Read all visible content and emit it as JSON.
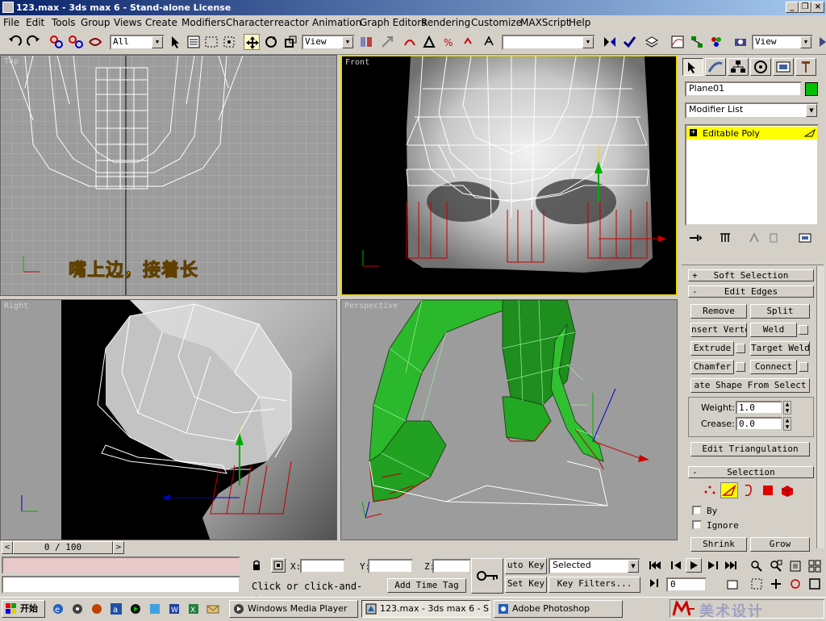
{
  "window": {
    "title": "123.max - 3ds max 6 - Stand-alone License"
  },
  "menu": [
    "File",
    "Edit",
    "Tools",
    "Group",
    "Views",
    "Create",
    "Modifiers",
    "Character",
    "reactor",
    "Animation",
    "Graph Editors",
    "Rendering",
    "Customize",
    "MAXScript",
    "Help"
  ],
  "toolbar": {
    "selection_filter": "All",
    "ref_coord": "View",
    "named_sel": "",
    "render_view": "View"
  },
  "viewports": {
    "top": {
      "label": "Top",
      "annotation": "嘴上边，接着长"
    },
    "front": {
      "label": "Front"
    },
    "right": {
      "label": "Right"
    },
    "perspective": {
      "label": "Perspective"
    }
  },
  "command_panel": {
    "object_name": "Plane01",
    "object_color": "#00c000",
    "modifier_list": "Modifier List",
    "stack_item": "Editable Poly",
    "soft_selection": "Soft Selection",
    "edit_edges": "Edit Edges",
    "buttons": {
      "remove": "Remove",
      "split": "Split",
      "insert_vertex": "nsert Verte",
      "weld": "Weld",
      "extrude": "Extrude",
      "target_weld": "Target Weld",
      "chamfer": "Chamfer",
      "connect": "Connect",
      "create_shape": "ate Shape From Select"
    },
    "weight_label": "Weight:",
    "weight_value": "1.0",
    "crease_label": "Crease:",
    "crease_value": "0.0",
    "edit_triangulation": "Edit Triangulation",
    "selection": "Selection",
    "by_label": "By",
    "ignore_label": "Ignore",
    "shrink": "Shrink",
    "grow": "Grow"
  },
  "timeline": {
    "frame": "0 / 100"
  },
  "status": {
    "x_label": "X:",
    "y_label": "Y:",
    "z_label": "Z:",
    "prompt": "Click or click-and-drag",
    "add_time_tag": "Add Time Tag",
    "auto_key": "uto Key",
    "set_key": "Set Key",
    "key_mode": "Selected",
    "key_filters": "Key Filters...",
    "current_frame": "0"
  },
  "taskbar": {
    "start": "开始",
    "tasks": [
      "Windows Media Player",
      "123.max - 3ds max 6 - S...",
      "Adobe Photoshop"
    ],
    "watermark": "美术设计"
  },
  "colors": {
    "active_viewport": "#e8d800",
    "highlight": "#ffff00",
    "title_start": "#0a246a",
    "mesh_green": "#22aa22"
  }
}
